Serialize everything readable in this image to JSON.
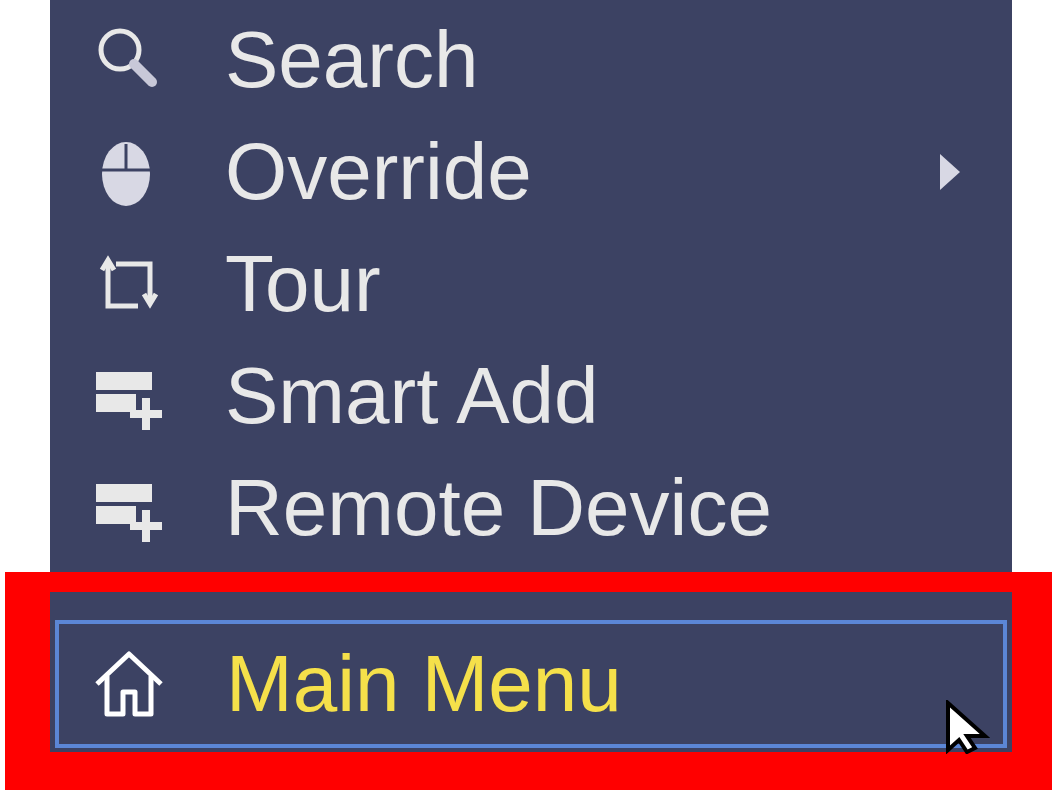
{
  "menu": {
    "items": [
      {
        "label": "Search",
        "submenu": false,
        "selected": false
      },
      {
        "label": "Override",
        "submenu": true,
        "selected": false
      },
      {
        "label": "Tour",
        "submenu": false,
        "selected": false
      },
      {
        "label": "Smart Add",
        "submenu": false,
        "selected": false
      },
      {
        "label": "Remote Device",
        "submenu": false,
        "selected": false
      },
      {
        "label": "Main Menu",
        "submenu": false,
        "selected": true
      }
    ]
  }
}
